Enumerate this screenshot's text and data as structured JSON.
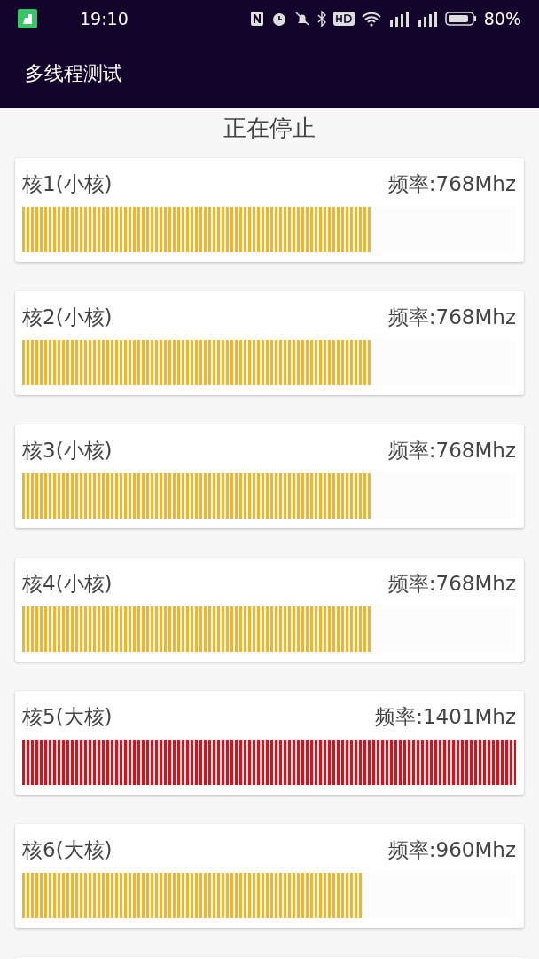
{
  "status_bar": {
    "time": "19:10",
    "battery": "80%"
  },
  "app_bar": {
    "title": "多线程测试"
  },
  "status_text": "正在停止",
  "cores": [
    {
      "name": "核1(小核)",
      "frequency": "频率:768Mhz",
      "level": 0.709,
      "color": "#e8b830"
    },
    {
      "name": "核2(小核)",
      "frequency": "频率:768Mhz",
      "level": 0.709,
      "color": "#e8b830"
    },
    {
      "name": "核3(小核)",
      "frequency": "频率:768Mhz",
      "level": 0.709,
      "color": "#e8b830"
    },
    {
      "name": "核4(小核)",
      "frequency": "频率:768Mhz",
      "level": 0.709,
      "color": "#e8b830"
    },
    {
      "name": "核5(大核)",
      "frequency": "频率:1401Mhz",
      "level": 1.0,
      "color": "#d0141e"
    },
    {
      "name": "核6(大核)",
      "frequency": "频率:960Mhz",
      "level": 0.689,
      "color": "#e8b830"
    }
  ]
}
